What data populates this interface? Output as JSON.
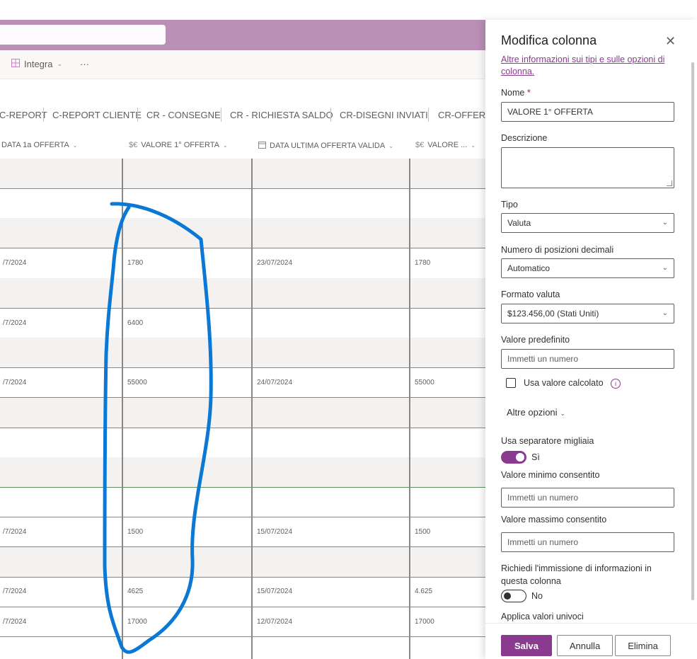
{
  "command_bar": {
    "integrate_label": "Integra",
    "more_label": "···"
  },
  "view_tabs": [
    "C-REPORT",
    "C-REPORT CLIENTE",
    "CR - CONSEGNE",
    "CR - RICHIESTA SALDO",
    "CR-DISEGNI INVIATI",
    "CR-OFFERTE"
  ],
  "columns": {
    "c1": "DATA 1a OFFERTA",
    "c2": "VALORE 1° OFFERTA",
    "c3": "DATA ULTIMA OFFERTA VALIDA",
    "c4": "VALORE ..."
  },
  "rows": [
    {
      "c1": "",
      "c2": "",
      "c3": "",
      "c4": ""
    },
    {
      "c1": "",
      "c2": "",
      "c3": "",
      "c4": ""
    },
    {
      "c1": "",
      "c2": "",
      "c3": "",
      "c4": ""
    },
    {
      "c1": "/7/2024",
      "c2": "1780",
      "c3": "23/07/2024",
      "c4": "1780"
    },
    {
      "c1": "",
      "c2": "",
      "c3": "",
      "c4": ""
    },
    {
      "c1": "/7/2024",
      "c2": "6400",
      "c3": "",
      "c4": ""
    },
    {
      "c1": "",
      "c2": "",
      "c3": "",
      "c4": ""
    },
    {
      "c1": "/7/2024",
      "c2": "55000",
      "c3": "24/07/2024",
      "c4": "55000"
    },
    {
      "c1": "",
      "c2": "",
      "c3": "",
      "c4": ""
    },
    {
      "c1": "",
      "c2": "",
      "c3": "",
      "c4": ""
    },
    {
      "c1": "",
      "c2": "",
      "c3": "",
      "c4": ""
    },
    {
      "c1": "",
      "c2": "",
      "c3": "",
      "c4": ""
    },
    {
      "c1": "/7/2024",
      "c2": "1500",
      "c3": "15/07/2024",
      "c4": "1500"
    },
    {
      "c1": "",
      "c2": "",
      "c3": "",
      "c4": ""
    },
    {
      "c1": "/7/2024",
      "c2": "4625",
      "c3": "15/07/2024",
      "c4": "4.625"
    },
    {
      "c1": "/7/2024",
      "c2": "17000",
      "c3": "12/07/2024",
      "c4": "17000"
    },
    {
      "c1": "",
      "c2": "",
      "c3": "",
      "c4": ""
    }
  ],
  "panel": {
    "title": "Modifica colonna",
    "info_link": "Altre informazioni sui tipi e sulle opzioni di colonna.",
    "name_label": "Nome",
    "required_mark": "*",
    "name_value": "VALORE 1° OFFERTA",
    "description_label": "Descrizione",
    "type_label": "Tipo",
    "type_value": "Valuta",
    "decimals_label": "Numero di posizioni decimali",
    "decimals_value": "Automatico",
    "currency_label": "Formato valuta",
    "currency_value": "$123.456,00 (Stati Uniti)",
    "default_label": "Valore predefinito",
    "default_placeholder": "Immetti un numero",
    "calc_label": "Usa valore calcolato",
    "info_glyph": "i",
    "more_options": "Altre opzioni",
    "thousands_label": "Usa separatore migliaia",
    "thousands_state": "Sì",
    "thousands_on": true,
    "min_label": "Valore minimo consentito",
    "min_placeholder": "Immetti un numero",
    "max_label": "Valore massimo consentito",
    "max_placeholder": "Immetti un numero",
    "required_label": "Richiedi l'immissione di informazioni in questa colonna",
    "required_state": "No",
    "required_on": false,
    "unique_label": "Applica valori univoci",
    "save": "Salva",
    "cancel": "Annulla",
    "delete": "Elimina"
  },
  "colors": {
    "suite_bar": "#b98fb6",
    "accent": "#8a3b8f",
    "annotation": "#0a78d4"
  }
}
